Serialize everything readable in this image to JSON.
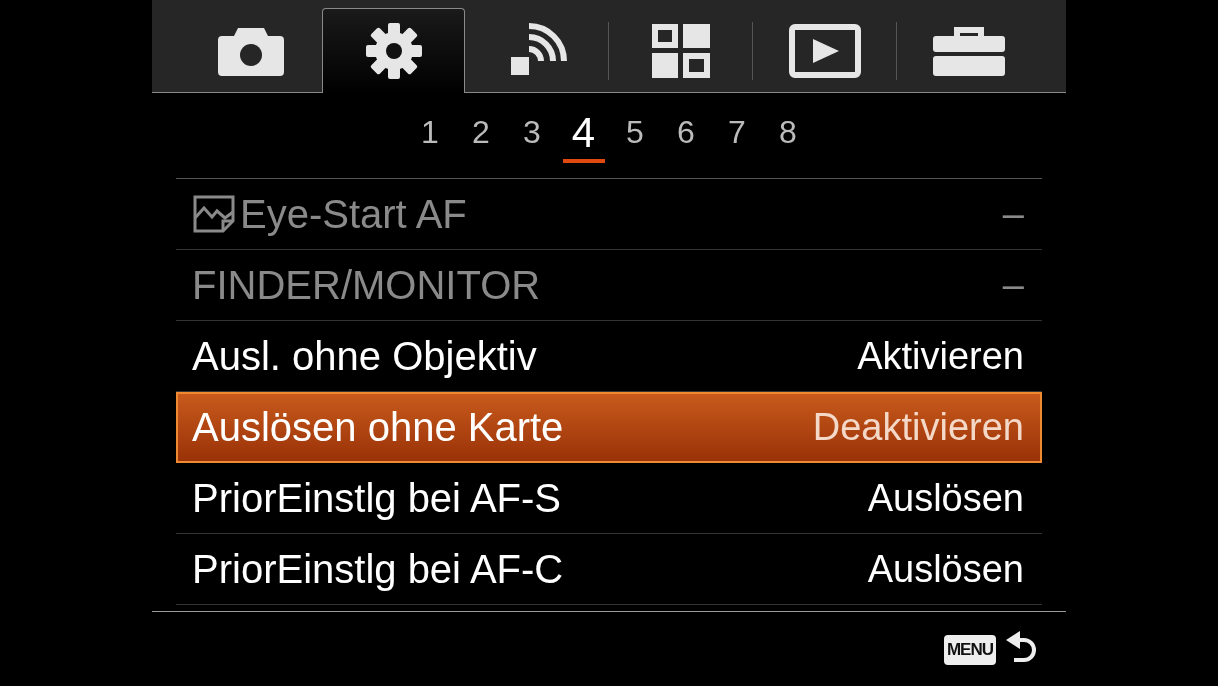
{
  "tabs": [
    {
      "kind": "camera",
      "selected": false
    },
    {
      "kind": "settings",
      "selected": true
    },
    {
      "kind": "wireless",
      "selected": false
    },
    {
      "kind": "grid",
      "selected": false
    },
    {
      "kind": "playback",
      "selected": false
    },
    {
      "kind": "toolbox",
      "selected": false
    }
  ],
  "pages": [
    {
      "label": "1",
      "selected": false
    },
    {
      "label": "2",
      "selected": false
    },
    {
      "label": "3",
      "selected": false
    },
    {
      "label": "4",
      "selected": true
    },
    {
      "label": "5",
      "selected": false
    },
    {
      "label": "6",
      "selected": false
    },
    {
      "label": "7",
      "selected": false
    },
    {
      "label": "8",
      "selected": false
    }
  ],
  "items": [
    {
      "kind": "photo-icon",
      "label": "Eye-Start AF",
      "value": "–",
      "disabled": true,
      "selected": false
    },
    {
      "kind": "plain",
      "label": "FINDER/MONITOR",
      "value": "–",
      "disabled": true,
      "selected": false
    },
    {
      "kind": "plain",
      "label": "Ausl. ohne Objektiv",
      "value": "Aktivieren",
      "disabled": false,
      "selected": false
    },
    {
      "kind": "plain",
      "label": "Auslösen ohne Karte",
      "value": "Deaktivieren",
      "disabled": false,
      "selected": true
    },
    {
      "kind": "plain",
      "label": "PriorEinstlg bei AF-S",
      "value": "Auslösen",
      "disabled": false,
      "selected": false
    },
    {
      "kind": "plain",
      "label": "PriorEinstlg bei AF-C",
      "value": "Auslösen",
      "disabled": false,
      "selected": false
    }
  ],
  "footer": {
    "menu_key": "MENU"
  }
}
